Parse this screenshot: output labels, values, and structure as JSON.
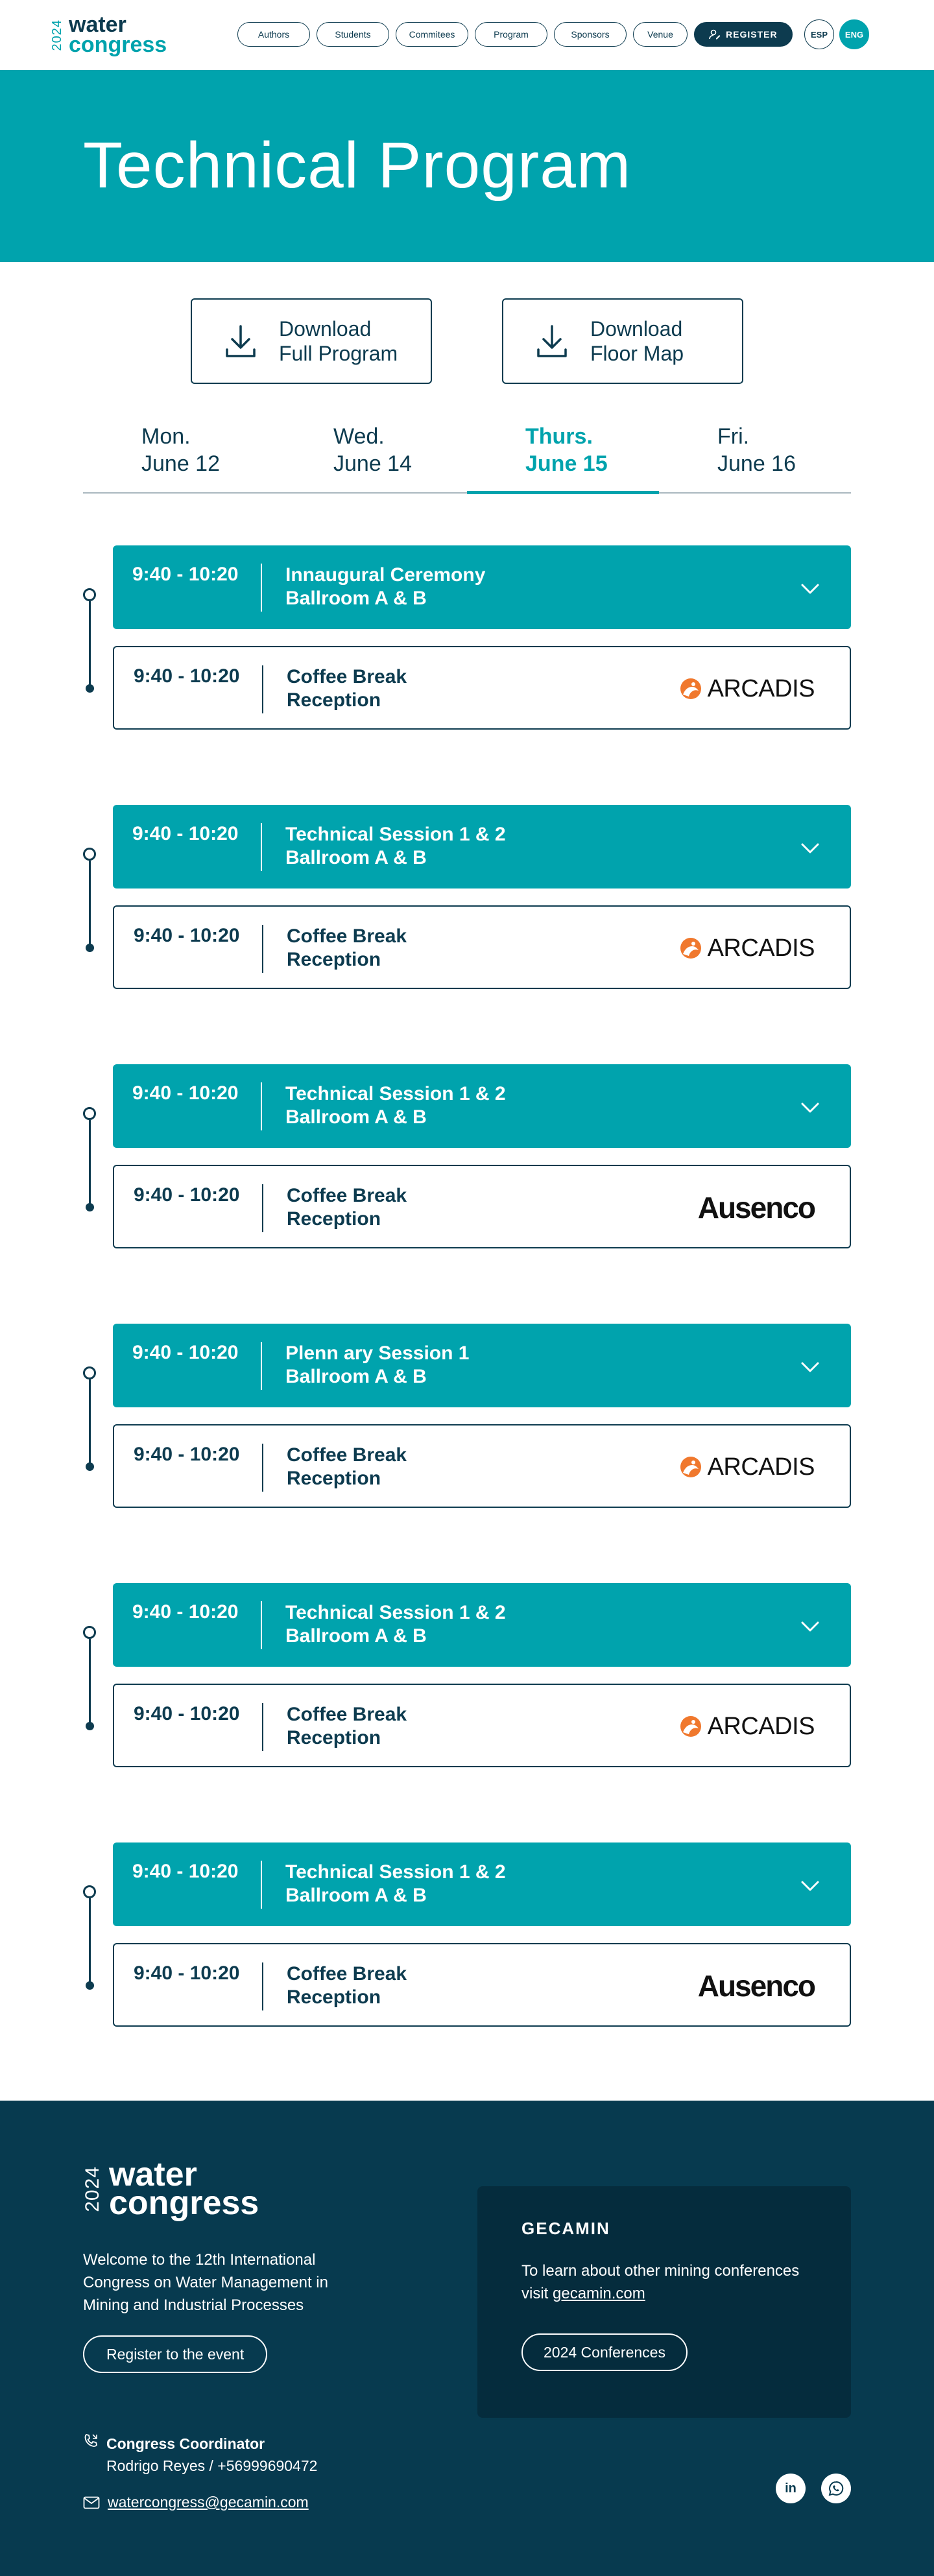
{
  "header": {
    "logo_year": "2024",
    "logo_line1": "water",
    "logo_line2": "congress",
    "nav": [
      "Authors",
      "Students",
      "Commitees",
      "Program",
      "Sponsors",
      "Venue"
    ],
    "register_label": "REGISTER",
    "languages": [
      "ESP",
      "ENG"
    ],
    "active_language": "ENG"
  },
  "hero": {
    "title": "Technical Program"
  },
  "downloads": [
    {
      "line1": "Download",
      "line2": "Full Program",
      "icon": "download-icon"
    },
    {
      "line1": "Download",
      "line2": "Floor Map",
      "icon": "download-icon"
    }
  ],
  "days": [
    {
      "weekday": "Mon.",
      "date": "June 12"
    },
    {
      "weekday": "Wed.",
      "date": "June 14"
    },
    {
      "weekday": "Thurs.",
      "date": "June 15",
      "active": true
    },
    {
      "weekday": "Fri.",
      "date": "June 16"
    }
  ],
  "schedule": [
    {
      "time": "9:40 - 10:20",
      "title1": "Innaugural Ceremony",
      "title2": "Ballroom A & B",
      "sub_time": "9:40 - 10:20",
      "sub_title1": "Coffee Break",
      "sub_title2": "Reception",
      "sponsor": "ARCADIS"
    },
    {
      "time": "9:40 - 10:20",
      "title1": "Technical Session 1 & 2",
      "title2": "Ballroom A & B",
      "sub_time": "9:40 - 10:20",
      "sub_title1": "Coffee Break",
      "sub_title2": "Reception",
      "sponsor": "ARCADIS"
    },
    {
      "time": "9:40 - 10:20",
      "title1": "Technical Session 1 & 2",
      "title2": "Ballroom A & B",
      "sub_time": "9:40 - 10:20",
      "sub_title1": "Coffee Break",
      "sub_title2": "Reception",
      "sponsor": "Ausenco"
    },
    {
      "time": "9:40 - 10:20",
      "title1": "Plenn ary Session 1",
      "title2": "Ballroom A & B",
      "sub_time": "9:40 - 10:20",
      "sub_title1": "Coffee Break",
      "sub_title2": "Reception",
      "sponsor": "ARCADIS"
    },
    {
      "time": "9:40 - 10:20",
      "title1": "Technical Session 1 & 2",
      "title2": "Ballroom A & B",
      "sub_time": "9:40 - 10:20",
      "sub_title1": "Coffee Break",
      "sub_title2": "Reception",
      "sponsor": "ARCADIS"
    },
    {
      "time": "9:40 - 10:20",
      "title1": "Technical Session 1 & 2",
      "title2": "Ballroom A & B",
      "sub_time": "9:40 - 10:20",
      "sub_title1": "Coffee Break",
      "sub_title2": "Reception",
      "sponsor": "Ausenco"
    }
  ],
  "footer": {
    "logo_year": "2024",
    "logo_line1": "water",
    "logo_line2": "congress",
    "welcome": "Welcome to the 12th International Congress on Water Management in Mining and Industrial Processes",
    "register_button": "Register to the event",
    "gecamin_brand": "GECAMIN",
    "learn_text": "To learn about other mining conferences visit",
    "learn_link": "gecamin.com",
    "conferences_button": "2024 Conferences",
    "coordinator_title": "Congress Coordinator",
    "coordinator_info": "Rodrigo Reyes / +56999690472",
    "email": "watercongress@gecamin.com",
    "socials": [
      "linkedin-icon",
      "whatsapp-icon"
    ]
  },
  "colors": {
    "teal": "#00a3ad",
    "navy": "#0d3b4f",
    "footer_bg": "#073a4f",
    "arcadis_orange": "#f0782d"
  }
}
